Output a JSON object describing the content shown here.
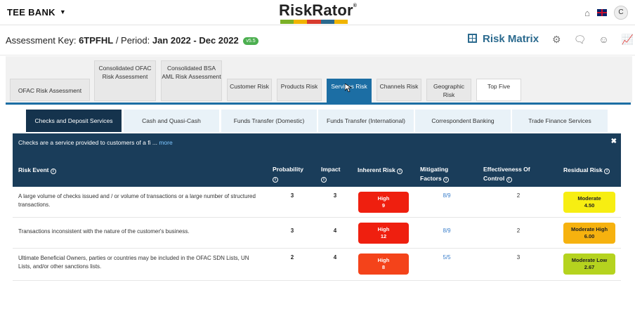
{
  "header": {
    "bank_name": "TEE BANK",
    "logo_text": "RiskRator",
    "logo_colors": [
      "#7bb026",
      "#f0b400",
      "#d83b2e",
      "#2b6a8e",
      "#f0b400"
    ],
    "avatar_letter": "C"
  },
  "subheader": {
    "key_label": "Assessment Key:",
    "key_value": "6TPFHL",
    "period_label": "/ Period:",
    "period_value": "Jan 2022 - Dec 2022",
    "version": "v5.5",
    "view_title": "Risk Matrix"
  },
  "primary_tabs": [
    {
      "label": "OFAC Risk Assessment"
    },
    {
      "label": "Consolidated OFAC Risk Assessment"
    },
    {
      "label": "Consolidated BSA AML Risk Assessment"
    },
    {
      "label": "Customer Risk"
    },
    {
      "label": "Products Risk"
    },
    {
      "label": "Services Risk"
    },
    {
      "label": "Channels Risk"
    },
    {
      "label": "Geographic Risk"
    },
    {
      "label": "Top Five"
    }
  ],
  "secondary_tabs": [
    {
      "label": "Checks and Deposit Services"
    },
    {
      "label": "Cash and Quasi-Cash"
    },
    {
      "label": "Funds Transfer (Domestic)"
    },
    {
      "label": "Funds Transfer (International)"
    },
    {
      "label": "Correspondent Banking"
    },
    {
      "label": "Trade Finance Services"
    }
  ],
  "info_banner": {
    "text": "Checks are a service provided to customers of a fi ...",
    "more": "more",
    "close": "✖"
  },
  "table": {
    "columns": {
      "risk_event": "Risk Event",
      "probability": "Probability",
      "impact": "Impact",
      "inherent": "Inherent Risk",
      "mitigating": "Mitigating Factors",
      "effectiveness": "Effectiveness Of Control",
      "residual": "Residual Risk"
    },
    "rows": [
      {
        "event": "A large volume of checks issued and / or volume of transactions or a large number of structured transactions.",
        "probability": "3",
        "impact": "3",
        "inherent_label": "High",
        "inherent_score": "9",
        "inherent_color": "#ef1f0f",
        "mitigating": "8/9",
        "effectiveness": "2",
        "residual_label": "Moderate",
        "residual_score": "4.50",
        "residual_color": "#f7ee12"
      },
      {
        "event": "Transactions inconsistent with the nature of the customer's business.",
        "probability": "3",
        "impact": "4",
        "inherent_label": "High",
        "inherent_score": "12",
        "inherent_color": "#ef1f0f",
        "mitigating": "8/9",
        "effectiveness": "2",
        "residual_label": "Moderate High",
        "residual_score": "6.00",
        "residual_color": "#f6b20f"
      },
      {
        "event": "Ultimate Beneficial Owners, parties or countries may be included in the OFAC SDN Lists, UN Lists, and/or other sanctions lists.",
        "probability": "2",
        "impact": "4",
        "inherent_label": "High",
        "inherent_score": "8",
        "inherent_color": "#f4431a",
        "mitigating": "5/5",
        "effectiveness": "3",
        "residual_label": "Moderate Low",
        "residual_score": "2.67",
        "residual_color": "#b5d31f"
      }
    ]
  }
}
